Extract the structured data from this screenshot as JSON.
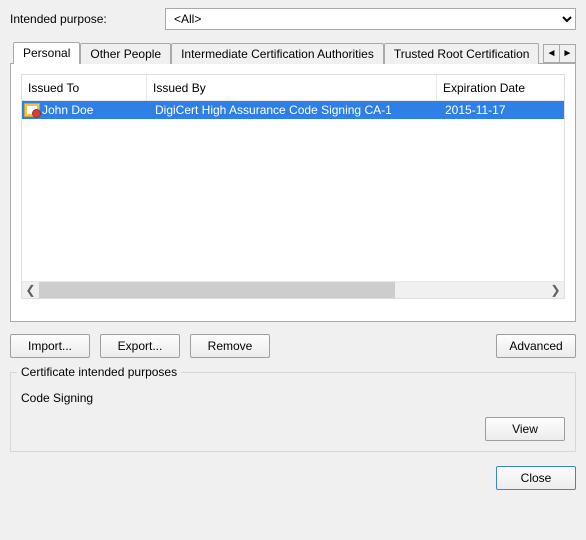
{
  "purpose": {
    "label": "Intended purpose:",
    "selected": "<All>"
  },
  "tabs": {
    "items": [
      {
        "label": "Personal",
        "active": true
      },
      {
        "label": "Other People",
        "active": false
      },
      {
        "label": "Intermediate Certification Authorities",
        "active": false
      },
      {
        "label": "Trusted Root Certification",
        "active": false
      }
    ]
  },
  "columns": {
    "issued_to": "Issued To",
    "issued_by": "Issued By",
    "expiration": "Expiration Date"
  },
  "rows": [
    {
      "issued_to": "John Doe",
      "issued_by": "DigiCert High Assurance Code Signing CA-1",
      "expiration": "2015-11-17",
      "selected": true
    }
  ],
  "buttons": {
    "import": "Import...",
    "export": "Export...",
    "remove": "Remove",
    "advanced": "Advanced",
    "view": "View",
    "close": "Close"
  },
  "group": {
    "title": "Certificate intended purposes",
    "value": "Code Signing"
  },
  "glyphs": {
    "left": "◄",
    "right": "►",
    "sleft": "❮",
    "sright": "❯"
  }
}
